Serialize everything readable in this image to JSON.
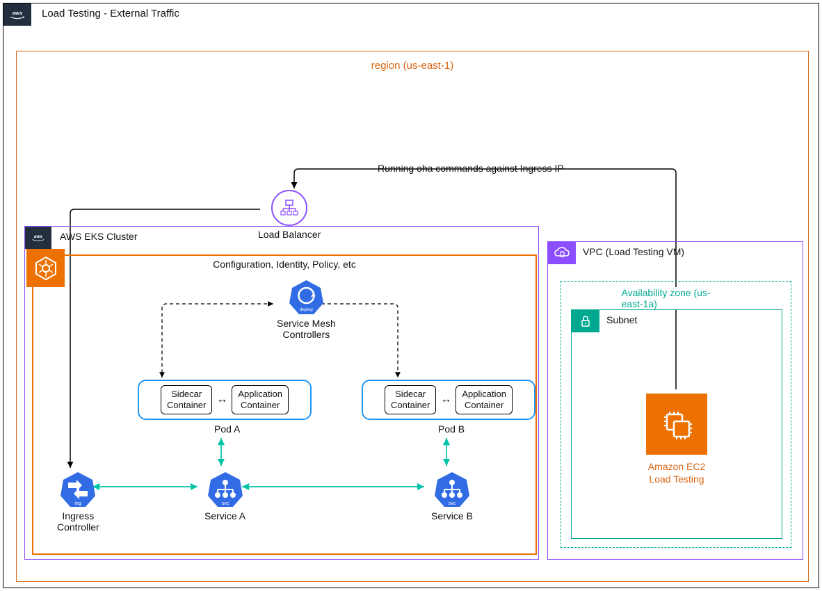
{
  "title": "Load Testing - External Traffic",
  "region": {
    "label": "region (us-east-1)"
  },
  "loadBalancer": {
    "label": "Load Balancer"
  },
  "arrowLabel": "Running oha commands against Ingress IP",
  "eks": {
    "label": "AWS EKS Cluster",
    "configLabel": "Configuration, Identity, Policy, etc",
    "meshLabel": "Service Mesh\nControllers",
    "podA": {
      "sidecar": "Sidecar\nContainer",
      "app": "Application\nContainer",
      "label": "Pod A"
    },
    "podB": {
      "sidecar": "Sidecar\nContainer",
      "app": "Application\nContainer",
      "label": "Pod B"
    },
    "ingress": "Ingress\nController",
    "svcA": "Service A",
    "svcB": "Service B"
  },
  "vpcLt": {
    "label": "VPC (Load Testing VM)",
    "azLabel": "Availability zone (us-east-1a)",
    "subnetLabel": "Subnet",
    "ec2Label": "Amazon EC2\nLoad Testing"
  }
}
